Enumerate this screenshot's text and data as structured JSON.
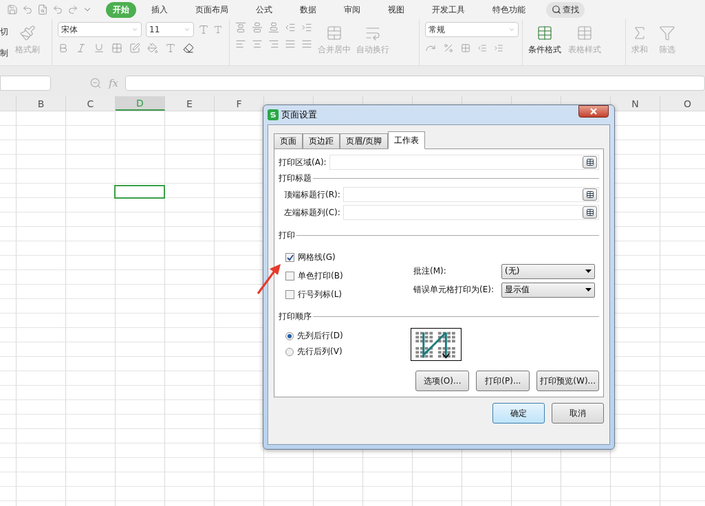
{
  "menu_tabs": [
    {
      "label": "开始",
      "selected": true
    },
    {
      "label": "插入",
      "selected": false
    },
    {
      "label": "页面布局",
      "selected": false
    },
    {
      "label": "公式",
      "selected": false
    },
    {
      "label": "数据",
      "selected": false
    },
    {
      "label": "审阅",
      "selected": false
    },
    {
      "label": "视图",
      "selected": false
    },
    {
      "label": "开发工具",
      "selected": false
    },
    {
      "label": "特色功能",
      "selected": false
    }
  ],
  "search_button": "查找",
  "ribbon": {
    "clipboard": [
      "切",
      "制"
    ],
    "format_painter": "格式刷",
    "font_name": "宋体",
    "font_size": "11",
    "merge": "合并居中",
    "wrap": "自动换行",
    "number_format": "常规",
    "fx_label": "fx",
    "conditional_format": "条件格式",
    "table_style": "表格样式",
    "sum": "求和",
    "filter": "筛选"
  },
  "columns": [
    {
      "label": "B",
      "selected": false
    },
    {
      "label": "C",
      "selected": false
    },
    {
      "label": "D",
      "selected": true
    },
    {
      "label": "E",
      "selected": false
    },
    {
      "label": "F",
      "selected": false
    },
    {
      "label": "N",
      "selected": false
    },
    {
      "label": "O",
      "selected": false
    }
  ],
  "dialog": {
    "title": "页面设置",
    "tabs": [
      {
        "label": "页面",
        "selected": false
      },
      {
        "label": "页边距",
        "selected": false
      },
      {
        "label": "页眉/页脚",
        "selected": false
      },
      {
        "label": "工作表",
        "selected": true
      }
    ],
    "print_area": {
      "label": "打印区域(A):"
    },
    "print_titles": {
      "heading": "打印标题",
      "rows": [
        {
          "label": "顶端标题行(R):"
        },
        {
          "label": "左端标题列(C):"
        }
      ]
    },
    "print": {
      "heading": "打印",
      "options": [
        {
          "label": "网格线(G)",
          "checked": true
        },
        {
          "label": "单色打印(B)",
          "checked": false
        },
        {
          "label": "行号列标(L)",
          "checked": false
        }
      ],
      "selects": [
        {
          "label": "批注(M):",
          "value": "(无)"
        },
        {
          "label": "错误单元格打印为(E):",
          "value": "显示值"
        }
      ]
    },
    "order": {
      "heading": "打印顺序",
      "options": [
        {
          "label": "先列后行(D)",
          "selected": true
        },
        {
          "label": "先行后列(V)",
          "selected": false
        }
      ]
    },
    "action_buttons": [
      "选项(O)...",
      "打印(P)...",
      "打印预览(W)..."
    ],
    "footer_buttons": [
      {
        "label": "确定",
        "default": true
      },
      {
        "label": "取消",
        "default": false
      }
    ]
  }
}
